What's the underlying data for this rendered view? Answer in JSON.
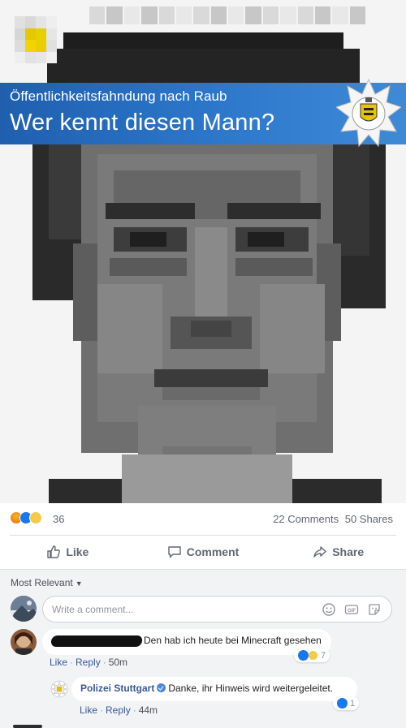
{
  "post": {
    "banner_subtitle": "Öffentlichkeitsfahndung nach Raub",
    "banner_title": "Wer kennt diesen Mann?",
    "reaction_count": "36",
    "comments_count": "22 Comments",
    "shares_count": "50 Shares"
  },
  "actions": {
    "like": "Like",
    "comment": "Comment",
    "share": "Share"
  },
  "comments_section": {
    "sort_label": "Most Relevant",
    "input_placeholder": "Write a comment..."
  },
  "comments": [
    {
      "author": "",
      "text": "Den hab ich heute bei Minecraft gesehen",
      "like_label": "Like",
      "reply_label": "Reply",
      "time": "50m",
      "reaction_count": "7"
    },
    {
      "author": "Polizei Stuttgart",
      "text": "Danke, ihr Hinweis wird weitergeleitet.",
      "like_label": "Like",
      "reply_label": "Reply",
      "time": "44m",
      "reaction_count": "1"
    }
  ],
  "colors": {
    "banner_blue": "#2d78cc",
    "link_blue": "#385898",
    "facebook_blue": "#1877f2"
  }
}
